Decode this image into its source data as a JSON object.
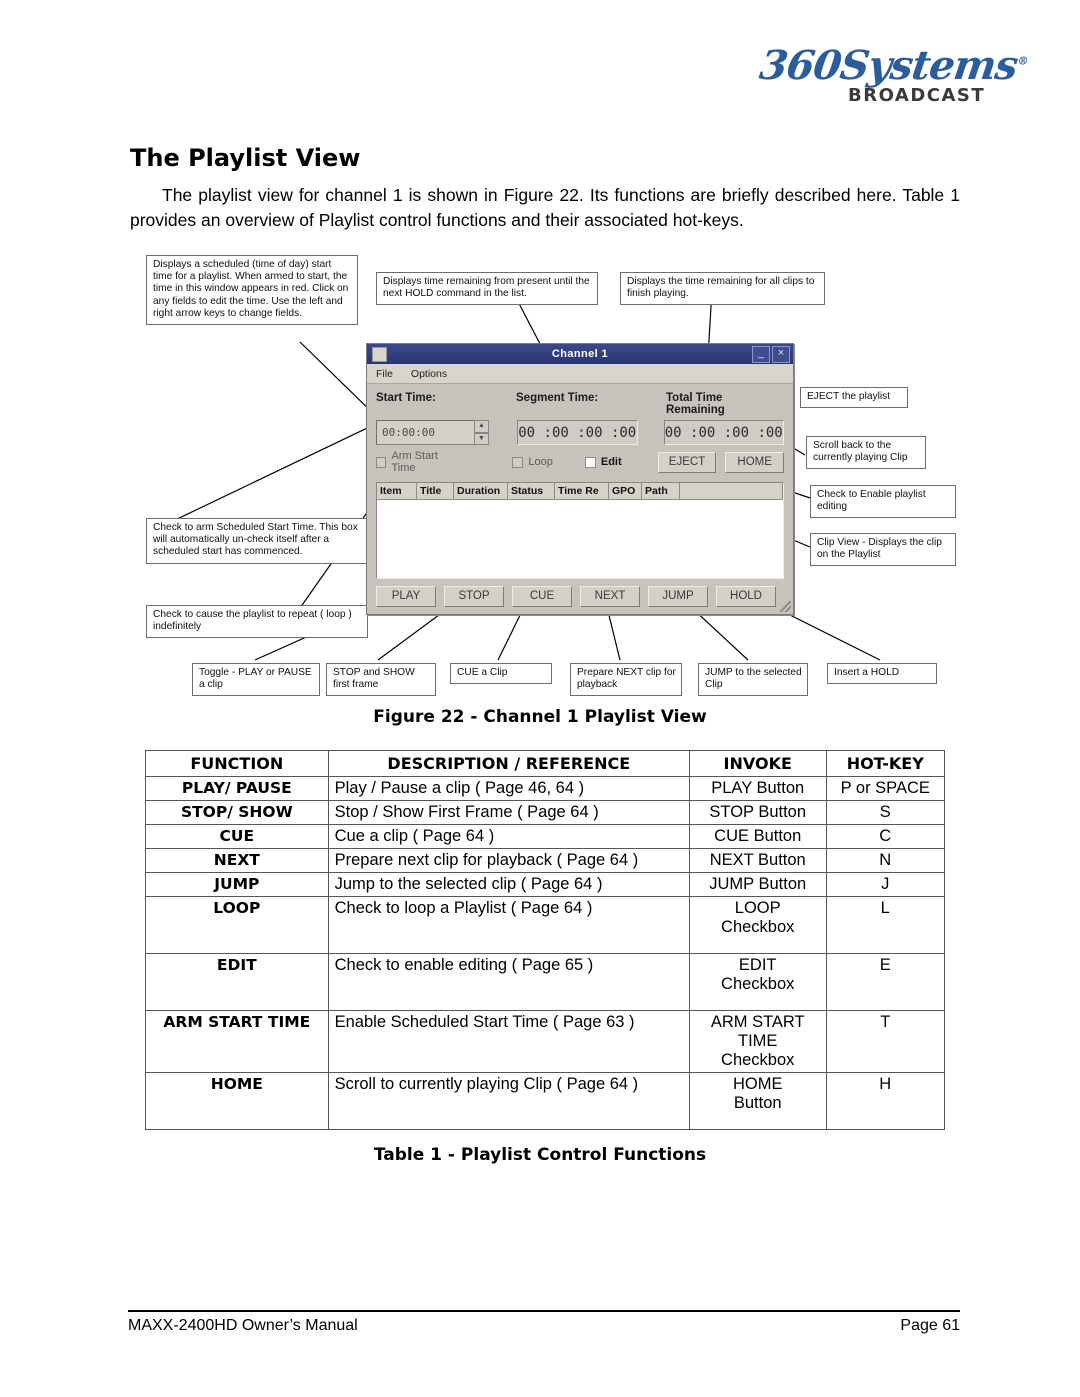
{
  "logo": {
    "script": "360Systems",
    "registered": "®",
    "broadcast": "BROADCAST"
  },
  "page_title": "The Playlist View",
  "intro": "The playlist view for channel 1 is shown in Figure 22. Its functions are briefly described here. Table 1 provides an overview of Playlist control functions and their associated hot-keys.",
  "figure": {
    "caption": "Figure 22 - Channel 1 Playlist View",
    "callouts": {
      "start_time": "Displays  a scheduled (time of day) start time for a playlist. When armed to start, the time in this window appears in red. Click on any fields to edit the time.  Use the left and right arrow keys to change fields.",
      "segment_time": "Displays time remaining from present until the next HOLD command in the list.",
      "total_time": "Displays the time remaining for all clips to finish playing.",
      "eject": "EJECT the playlist",
      "home": "Scroll back to the currently playing Clip",
      "edit": "Check to Enable playlist editing",
      "clip_view": "Clip View - Displays the clip on the Playlist",
      "arm_start": "Check to arm Scheduled Start Time.  This box will automatically un-check itself after a scheduled start has commenced.",
      "loop": "Check to cause the playlist to repeat ( loop ) indefinitely",
      "play": "Toggle - PLAY or PAUSE a clip",
      "stop": "STOP and SHOW first frame",
      "cue": "CUE a Clip",
      "next": "Prepare NEXT clip for playback",
      "jump": "JUMP to the selected Clip",
      "hold": "Insert a HOLD"
    },
    "window": {
      "title": "Channel  1",
      "minimize_label": "_",
      "close_label": "×",
      "menus": [
        "File",
        "Options"
      ],
      "labels": {
        "start_time": "Start Time:",
        "segment_time": "Segment Time:",
        "total_time": "Total Time Remaining"
      },
      "values": {
        "start_time": "00:00:00",
        "segment_time": "00 :00 :00 :00",
        "total_time": "00 :00 :00 :00"
      },
      "checkboxes": [
        {
          "label": "Arm Start Time",
          "checked": false
        },
        {
          "label": "Loop",
          "checked": false
        },
        {
          "label": "Edit",
          "checked": false
        }
      ],
      "top_buttons": [
        "EJECT",
        "HOME"
      ],
      "grid_columns": [
        "Item",
        "Title",
        "Duration",
        "Status",
        "Time Re",
        "GPO",
        "Path"
      ],
      "bottom_buttons": [
        "PLAY",
        "STOP",
        "CUE",
        "NEXT",
        "JUMP",
        "HOLD"
      ]
    }
  },
  "table": {
    "caption": "Table 1 - Playlist Control Functions",
    "headers": [
      "FUNCTION",
      "DESCRIPTION / REFERENCE",
      "INVOKE",
      "HOT-KEY"
    ],
    "rows": [
      {
        "function": "PLAY/ PAUSE",
        "description": "Play / Pause a clip ( Page 46, 64 )",
        "invoke": "PLAY Button",
        "hotkey": "P or SPACE",
        "tall": false
      },
      {
        "function": "STOP/ SHOW",
        "description": "Stop / Show First Frame  ( Page 64 )",
        "invoke": "STOP Button",
        "hotkey": "S",
        "tall": false
      },
      {
        "function": "CUE",
        "description": "Cue a clip ( Page 64 )",
        "invoke": "CUE Button",
        "hotkey": "C",
        "tall": false
      },
      {
        "function": "NEXT",
        "description": "Prepare next clip for playback ( Page 64 )",
        "invoke": "NEXT Button",
        "hotkey": "N",
        "tall": false
      },
      {
        "function": "JUMP",
        "description": "Jump to the selected clip ( Page 64 )",
        "invoke": "JUMP Button",
        "hotkey": "J",
        "tall": false
      },
      {
        "function": "LOOP",
        "description": "Check to loop a Playlist ( Page 64 )",
        "invoke": "LOOP\nCheckbox",
        "hotkey": "L",
        "tall": true
      },
      {
        "function": "EDIT",
        "description": "Check to enable editing ( Page 65 )",
        "invoke": "EDIT\nCheckbox",
        "hotkey": "E",
        "tall": true
      },
      {
        "function": "ARM START TIME",
        "description": "Enable Scheduled Start Time  ( Page 63 )",
        "invoke": "ARM START\nTIME\nCheckbox",
        "hotkey": "T",
        "tall": true
      },
      {
        "function": "HOME",
        "description": "Scroll to currently playing Clip ( Page 64 )",
        "invoke": "HOME\nButton",
        "hotkey": "H",
        "tall": true
      }
    ]
  },
  "footer": {
    "left": "MAXX-2400HD Owner’s Manual",
    "right": "Page 61"
  }
}
